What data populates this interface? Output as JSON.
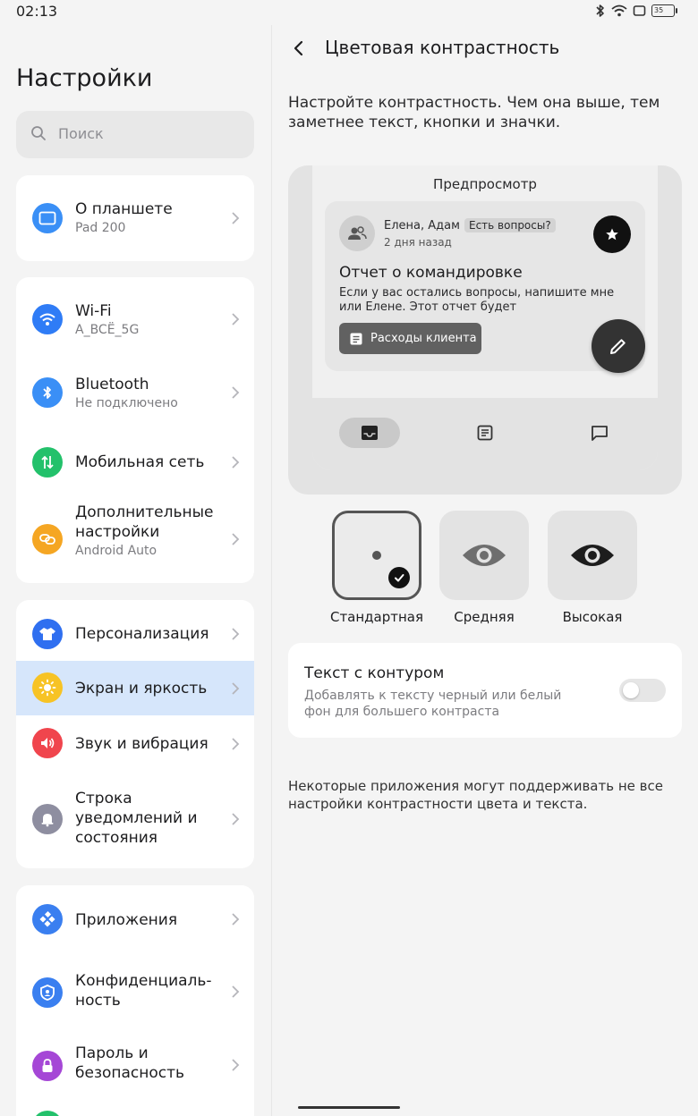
{
  "status_bar": {
    "time": "02:13",
    "battery": "35",
    "icons": [
      "bluetooth-icon",
      "wifi-icon",
      "screen-icon",
      "battery-icon"
    ]
  },
  "left": {
    "title": "Настройки",
    "search_placeholder": "Поиск",
    "cards": [
      {
        "items": [
          {
            "icon": "tablet-icon",
            "color": "#3a8ff6",
            "title": "О планшете",
            "subtitle": "Pad 200"
          }
        ]
      },
      {
        "items": [
          {
            "icon": "wifi-icon",
            "color": "#2f7cf6",
            "title": "Wi-Fi",
            "subtitle": "A_BCЁ_5G"
          },
          {
            "icon": "bluetooth-icon",
            "color": "#3a8ff6",
            "title": "Bluetooth",
            "subtitle": "Не подключено"
          },
          {
            "icon": "mobile-data-icon",
            "color": "#23c16b",
            "title": "Мобильная сеть",
            "subtitle": ""
          },
          {
            "icon": "more-connections-icon",
            "color": "#f5a623",
            "title": "Дополнительные настройки",
            "subtitle": "Android Auto"
          }
        ]
      },
      {
        "items": [
          {
            "icon": "tshirt-icon",
            "color": "#2f6ff0",
            "title": "Персонализация",
            "subtitle": ""
          },
          {
            "icon": "sun-icon",
            "color": "#f7c325",
            "title": "Экран и яркость",
            "subtitle": "",
            "active": true
          },
          {
            "icon": "speaker-icon",
            "color": "#f0454d",
            "title": "Звук и вибрация",
            "subtitle": ""
          },
          {
            "icon": "bell-icon",
            "color": "#8e8ea0",
            "title": "Строка уведомлений и состояния",
            "subtitle": ""
          }
        ]
      },
      {
        "items": [
          {
            "icon": "apps-icon",
            "color": "#3a7ff0",
            "title": "Приложения",
            "subtitle": ""
          },
          {
            "icon": "privacy-shield-icon",
            "color": "#3a7ff0",
            "title": "Конфиденциаль-ность",
            "subtitle": ""
          },
          {
            "icon": "lock-icon",
            "color": "#a547d6",
            "title": "Пароль и безопасность",
            "subtitle": ""
          }
        ]
      }
    ],
    "active_color": "#d6e6fb"
  },
  "right": {
    "title": "Цветовая контрастность",
    "description": "Настройте контрастность. Чем она выше, тем заметнее текст, кнопки и значки.",
    "preview": {
      "label": "Предпросмотр",
      "from": "Елена, Адам",
      "tag": "Есть вопросы?",
      "time": "2 дня назад",
      "subject": "Отчет о командировке",
      "body": "Если у вас остались вопросы, напишите мне или Елене. Этот отчет будет",
      "chip": "Расходы клиента"
    },
    "contrast_options": [
      {
        "label": "Стандартная",
        "selected": true
      },
      {
        "label": "Средняя",
        "selected": false
      },
      {
        "label": "Высокая",
        "selected": false
      }
    ],
    "outline_text": {
      "title": "Текст с контуром",
      "subtitle": "Добавлять к тексту черный или белый фон для большего контраста",
      "enabled": false
    },
    "footnote": "Некоторые приложения могут поддерживать не все настройки контрастности цвета и текста."
  }
}
